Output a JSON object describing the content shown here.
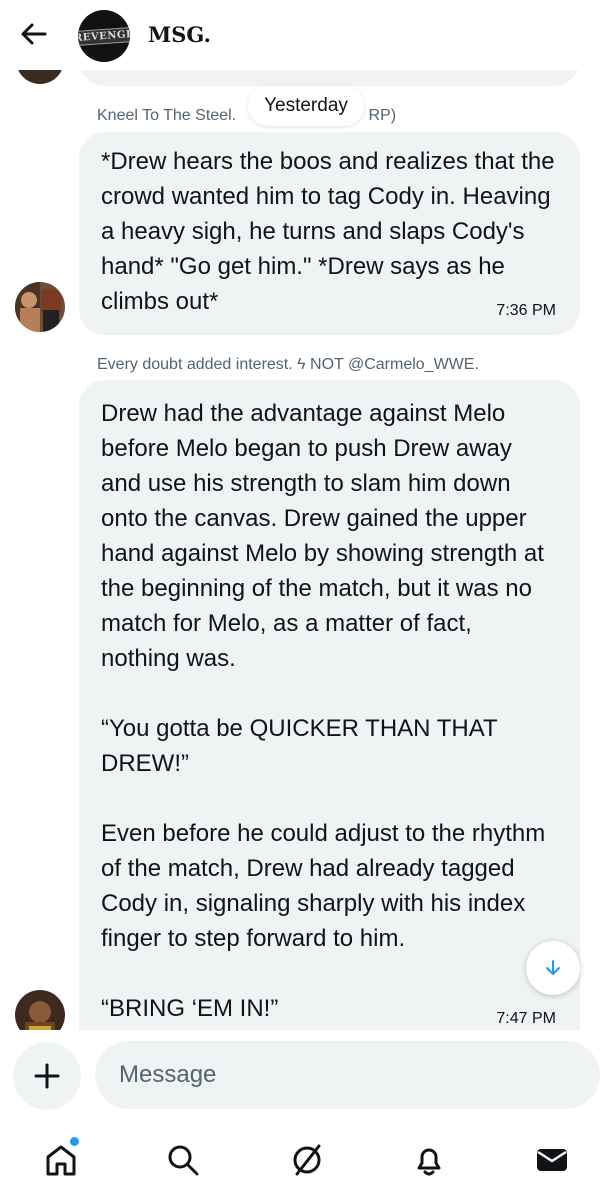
{
  "header": {
    "title": "MSG.",
    "avatar_text": "REVENGE"
  },
  "divider": {
    "label": "Yesterday"
  },
  "messages": [
    {
      "sender": "Kneel To The Steel.",
      "sender_suffix": "RP)",
      "text": "*Drew hears the boos and realizes that the crowd wanted him to tag Cody in. Heaving a heavy sigh, he turns and slaps Cody's hand* \"Go get him.\" *Drew says as he climbs out*",
      "time": "7:36 PM"
    },
    {
      "sender": "Every doubt added interest. ϟ NOT @Carmelo_WWE.",
      "text": "Drew had the advantage against Melo before Melo began to push Drew away and use his strength to slam him down onto the canvas. Drew gained the upper hand against Melo by showing strength at the beginning of the match, but it was no match for Melo, as a matter of fact, nothing was.\n\n“You gotta be QUICKER THAN THAT DREW!”\n\nEven before he could adjust to the rhythm of the match, Drew had already tagged Cody in, signaling sharply with his index finger to step forward to him.\n\n“BRING ‘EM IN!”",
      "time": "7:47 PM"
    }
  ],
  "composer": {
    "placeholder": "Message"
  },
  "nav": {
    "items": [
      "home-icon",
      "search-icon",
      "grok-icon",
      "notifications-icon",
      "messages-icon"
    ]
  },
  "colors": {
    "accent": "#1d9bf0",
    "bubble": "#eff3f4",
    "secondary_text": "#536471"
  }
}
